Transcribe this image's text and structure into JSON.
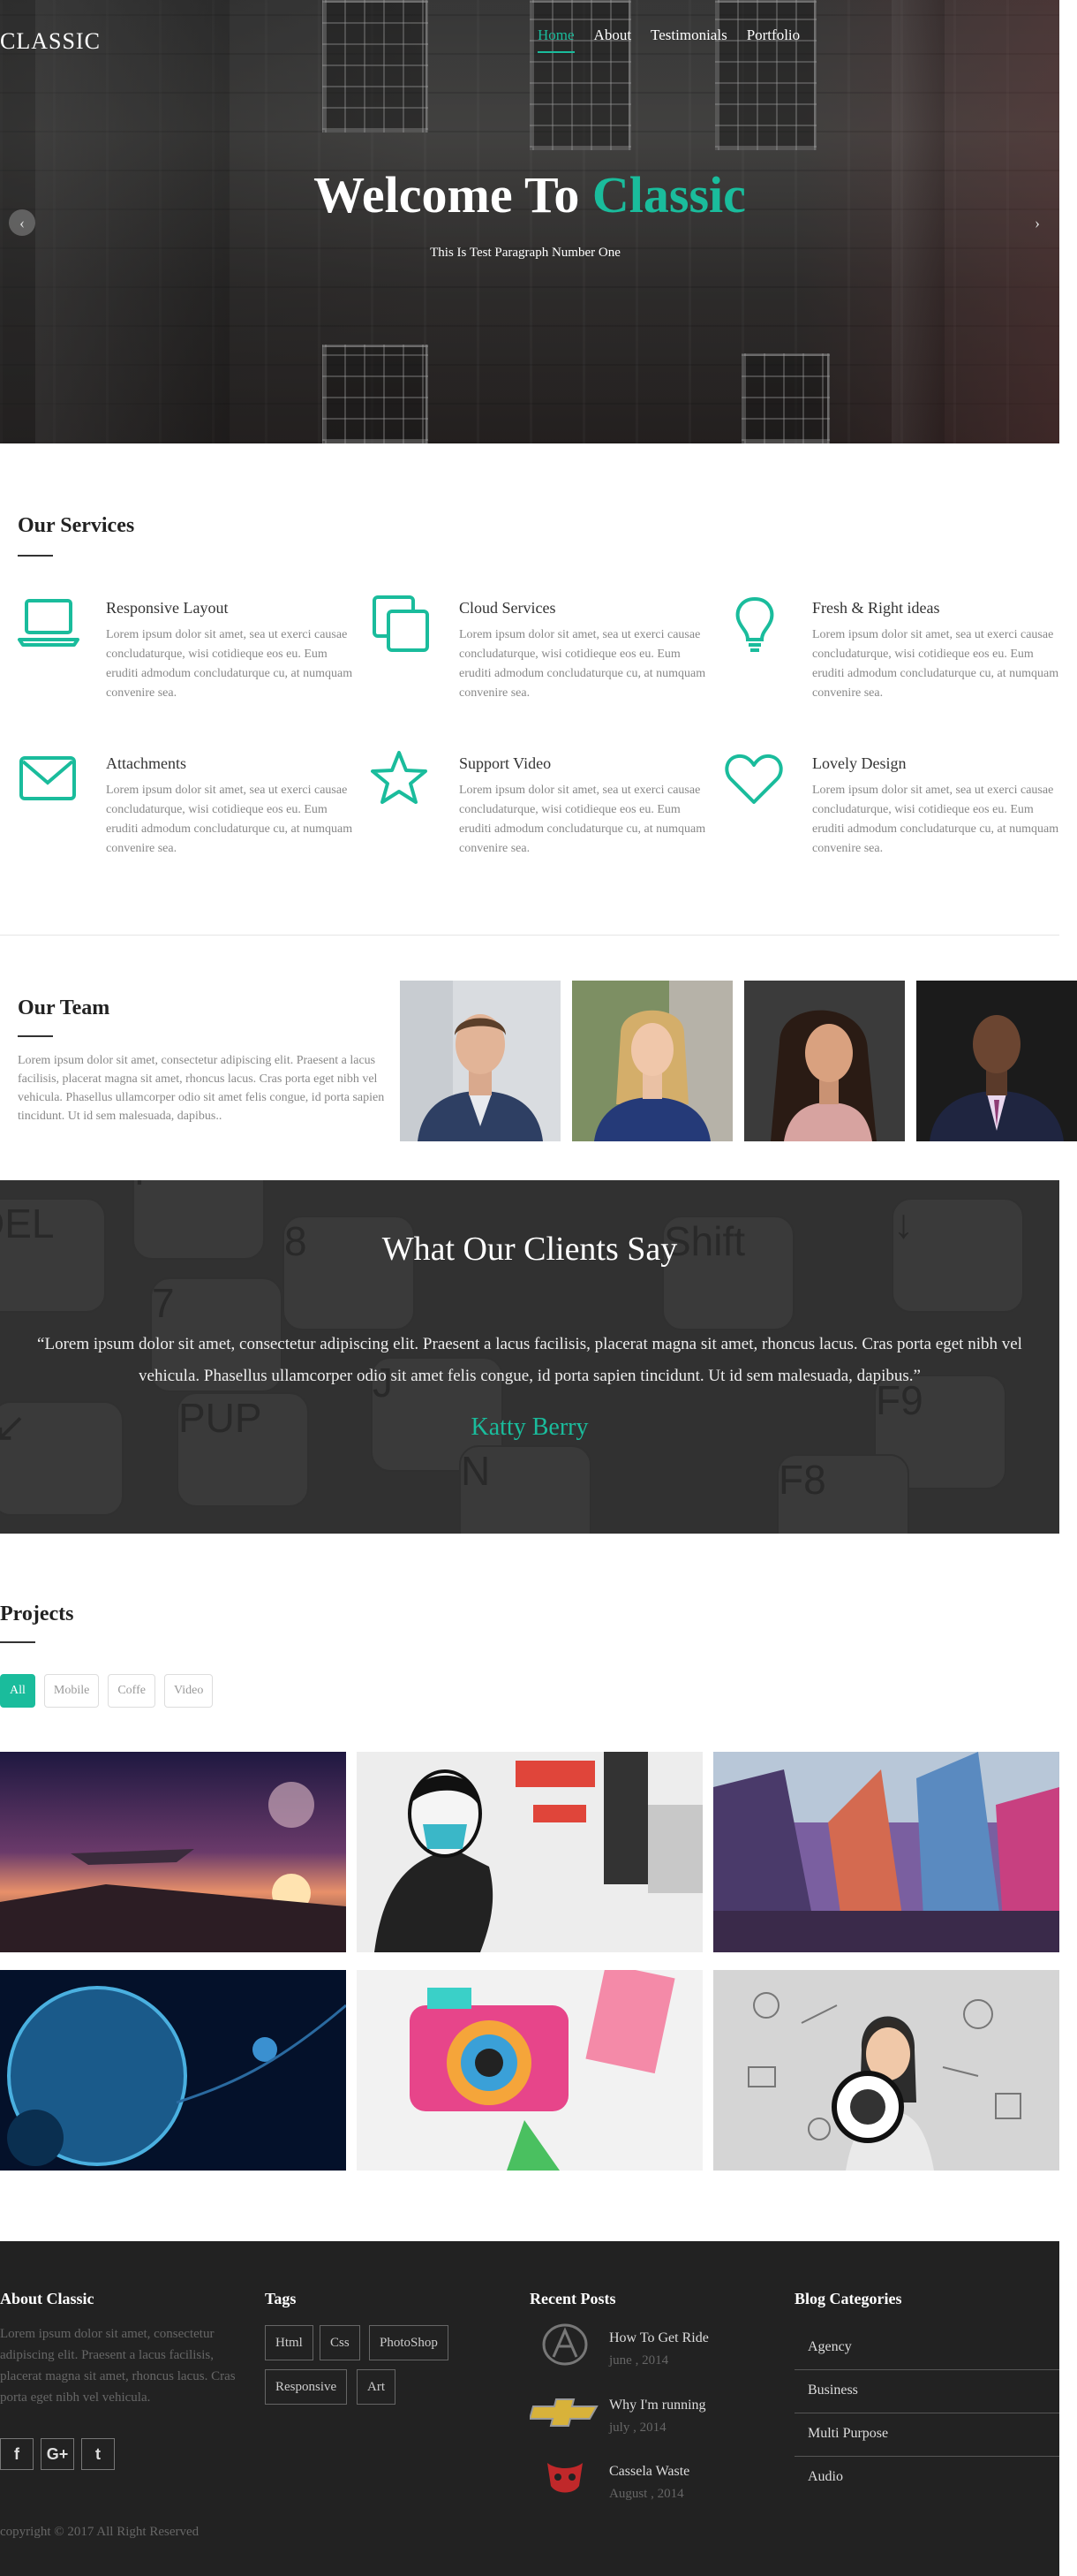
{
  "header": {
    "logo": "CLASSIC",
    "nav": [
      "Home",
      "About",
      "Testimonials",
      "Portfolio"
    ]
  },
  "hero": {
    "title_part1": "Welcome To ",
    "title_part2": "Classic",
    "subtitle": "This Is Test Paragraph Number One",
    "prev_arrow": "‹",
    "next_arrow": "›"
  },
  "services": {
    "title": "Our Services",
    "items": [
      {
        "icon": "laptop-icon",
        "title": "Responsive Layout",
        "text": "Lorem ipsum dolor sit amet, sea ut exerci causae concludaturque, wisi cotidieque eos eu. Eum eruditi admodum concludaturque cu, at numquam convenire sea."
      },
      {
        "icon": "copy-icon",
        "title": "Cloud Services",
        "text": "Lorem ipsum dolor sit amet, sea ut exerci causae concludaturque, wisi cotidieque eos eu. Eum eruditi admodum concludaturque cu, at numquam convenire sea."
      },
      {
        "icon": "lightbulb-icon",
        "title": "Fresh & Right ideas",
        "text": "Lorem ipsum dolor sit amet, sea ut exerci causae concludaturque, wisi cotidieque eos eu. Eum eruditi admodum concludaturque cu, at numquam convenire sea."
      },
      {
        "icon": "envelope-icon",
        "title": "Attachments",
        "text": "Lorem ipsum dolor sit amet, sea ut exerci causae concludaturque, wisi cotidieque eos eu. Eum eruditi admodum concludaturque cu, at numquam convenire sea."
      },
      {
        "icon": "star-icon",
        "title": "Support Video",
        "text": "Lorem ipsum dolor sit amet, sea ut exerci causae concludaturque, wisi cotidieque eos eu. Eum eruditi admodum concludaturque cu, at numquam convenire sea."
      },
      {
        "icon": "heart-icon",
        "title": "Lovely Design",
        "text": "Lorem ipsum dolor sit amet, sea ut exerci causae concludaturque, wisi cotidieque eos eu. Eum eruditi admodum concludaturque cu, at numquam convenire sea."
      }
    ]
  },
  "team": {
    "title": "Our Team",
    "text": "Lorem ipsum dolor sit amet, consectetur adipiscing elit. Praesent a lacus facilisis, placerat magna sit amet, rhoncus lacus. Cras porta eget nibh vel vehicula. Phasellus ullamcorper odio sit amet felis congue, id porta sapien tincidunt. Ut id sem malesuada, dapibus.."
  },
  "testimonials": {
    "title": "What Our Clients Say",
    "quote": "“Lorem ipsum dolor sit amet, consectetur adipiscing elit. Praesent a lacus facilisis, placerat magna sit amet, rhoncus lacus. Cras porta eget nibh vel vehicula. Phasellus ullamcorper odio sit amet felis congue, id porta sapien tincidunt. Ut id sem malesuada, dapibus.”",
    "author": "Katty Berry"
  },
  "projects": {
    "title": "Projects",
    "filters": [
      "All",
      "Mobile",
      "Coffe",
      "Video"
    ]
  },
  "footer": {
    "about_title": "About Classic",
    "about_text": "Lorem ipsum dolor sit amet, consectetur adipiscing elit. Praesent a lacus facilisis, placerat magna sit amet, rhoncus lacus. Cras porta eget nibh vel vehicula.",
    "social": [
      "f",
      "G+",
      "t"
    ],
    "tags_title": "Tags",
    "tags": [
      "Html",
      "Css",
      "PhotoShop",
      "Responsive",
      "Art"
    ],
    "posts_title": "Recent Posts",
    "posts": [
      {
        "title": "How To Get Ride",
        "date": "june , 2014",
        "logo": "acura-logo"
      },
      {
        "title": "Why I'm running",
        "date": "july , 2014",
        "logo": "chevrolet-logo"
      },
      {
        "title": "Cassela Waste",
        "date": "August , 2014",
        "logo": "dodge-logo"
      }
    ],
    "cats_title": "Blog Categories",
    "categories": [
      "Agency",
      "Business",
      "Multi Purpose",
      "Audio"
    ],
    "copyright": "copyright © 2017 All Right Reserved"
  },
  "colors": {
    "accent": "#1abc9c",
    "footer_bg": "#222222"
  }
}
